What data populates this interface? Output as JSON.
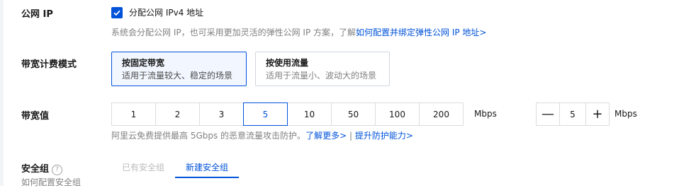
{
  "public_ip": {
    "label": "公网 IP",
    "checkbox_label": "分配公网 IPv4 地址",
    "checked": true,
    "help_text": "系统会分配公网 IP，也可采用更加灵活的弹性公网 IP 方案，了解",
    "help_link": "如何配置并绑定弹性公网 IP 地址>"
  },
  "billing": {
    "label": "带宽计费模式",
    "options": [
      {
        "title": "按固定带宽",
        "desc": "适用于流量较大、稳定的场景",
        "selected": true
      },
      {
        "title": "按使用流量",
        "desc": "适用于流量小、波动大的场景",
        "selected": false
      }
    ]
  },
  "bandwidth": {
    "label": "带宽值",
    "options": [
      "1",
      "2",
      "3",
      "5",
      "10",
      "50",
      "100",
      "200"
    ],
    "selected": "5",
    "unit": "Mbps",
    "stepper_value": "5",
    "stepper_unit": "Mbps",
    "minus": "—",
    "plus": "+",
    "help_text": "阿里云免费提供最高 5Gbps 的恶意流量攻击防护。",
    "help_link1": "了解更多>",
    "sep": "|",
    "help_link2": "提升防护能力>"
  },
  "security_group": {
    "label": "安全组",
    "help_icon": "?",
    "tabs": [
      {
        "label": "已有安全组",
        "state": "disabled"
      },
      {
        "label": "新建安全组",
        "state": "active"
      }
    ],
    "sub_label": "如何配置安全组"
  }
}
